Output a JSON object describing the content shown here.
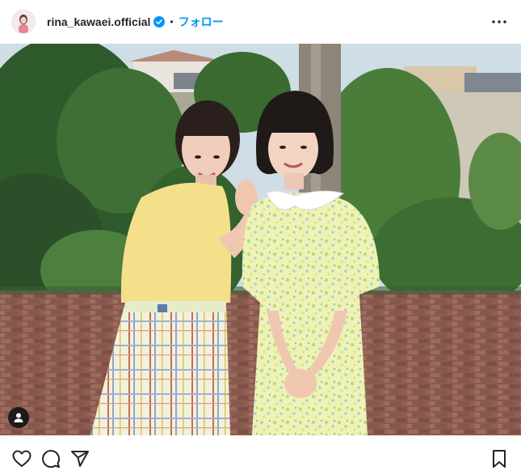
{
  "post": {
    "username": "rina_kawaei.official",
    "separator": "•",
    "follow_label": "フォロー"
  },
  "icons": {
    "verified": "verified-badge-icon",
    "more": "more-options-icon",
    "tag": "tagged-user-icon",
    "like": "heart-icon",
    "comment": "comment-icon",
    "share": "send-icon",
    "save": "bookmark-icon"
  },
  "colors": {
    "follow": "#0095f6",
    "verified": "#0095f6",
    "text": "#262626"
  }
}
